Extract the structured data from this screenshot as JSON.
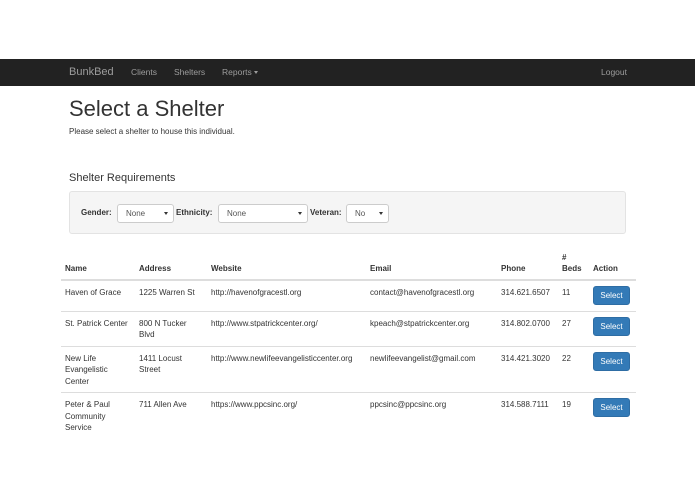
{
  "navbar": {
    "brand": "BunkBed",
    "items": [
      {
        "label": "Clients"
      },
      {
        "label": "Shelters"
      },
      {
        "label": "Reports"
      }
    ],
    "logout": "Logout"
  },
  "page": {
    "title": "Select a Shelter",
    "subtitle": "Please select a shelter to house this individual."
  },
  "requirements": {
    "title": "Shelter Requirements",
    "gender_label": "Gender:",
    "gender_value": "None",
    "ethnicity_label": "Ethnicity:",
    "ethnicity_value": "None",
    "veteran_label": "Veteran:",
    "veteran_value": "No"
  },
  "table": {
    "headers": {
      "name": "Name",
      "address": "Address",
      "website": "Website",
      "email": "Email",
      "phone": "Phone",
      "beds_hash": "#",
      "beds": "Beds",
      "action": "Action"
    },
    "rows": [
      {
        "name": "Haven of Grace",
        "address": "1225 Warren St",
        "website": "http://havenofgracestl.org",
        "email": "contact@havenofgracestl.org",
        "phone": "314.621.6507",
        "beds": "11",
        "action": "Select"
      },
      {
        "name": "St. Patrick Center",
        "address": "800 N Tucker Blvd",
        "website": "http://www.stpatrickcenter.org/",
        "email": "kpeach@stpatrickcenter.org",
        "phone": "314.802.0700",
        "beds": "27",
        "action": "Select"
      },
      {
        "name": "New Life Evangelistic Center",
        "address": "1411 Locust Street",
        "website": "http://www.newlifeevangelisticcenter.org",
        "email": "newlifeevangelist@gmail.com",
        "phone": "314.421.3020",
        "beds": "22",
        "action": "Select"
      },
      {
        "name": "Peter & Paul Community Service",
        "address": "711 Allen Ave",
        "website": "https://www.ppcsinc.org/",
        "email": "ppcsinc@ppcsinc.org",
        "phone": "314.588.7111",
        "beds": "19",
        "action": "Select"
      }
    ]
  }
}
